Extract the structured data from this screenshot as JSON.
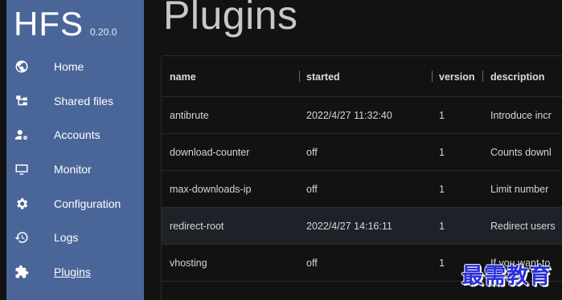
{
  "app": {
    "name": "HFS",
    "version": "0.20.0"
  },
  "sidebar": {
    "items": [
      {
        "label": "Home",
        "icon": "globe-icon"
      },
      {
        "label": "Shared files",
        "icon": "folder-tree-icon"
      },
      {
        "label": "Accounts",
        "icon": "user-gear-icon"
      },
      {
        "label": "Monitor",
        "icon": "monitor-icon"
      },
      {
        "label": "Configuration",
        "icon": "gear-icon"
      },
      {
        "label": "Logs",
        "icon": "history-icon"
      },
      {
        "label": "Plugins",
        "icon": "puzzle-icon",
        "active": true
      }
    ]
  },
  "main": {
    "title": "Plugins",
    "table": {
      "columns": [
        "name",
        "started",
        "version",
        "description"
      ],
      "rows": [
        {
          "name": "antibrute",
          "started": "2022/4/27 11:32:40",
          "version": "1",
          "description": "Introduce incr"
        },
        {
          "name": "download-counter",
          "started": "off",
          "version": "1",
          "description": "Counts downl"
        },
        {
          "name": "max-downloads-ip",
          "started": "off",
          "version": "1",
          "description": "Limit number"
        },
        {
          "name": "redirect-root",
          "started": "2022/4/27 14:16:11",
          "version": "1",
          "description": "Redirect users"
        },
        {
          "name": "vhosting",
          "started": "off",
          "version": "1",
          "description": "If you want to"
        }
      ]
    }
  },
  "watermark": {
    "text": "最需教育"
  },
  "colors": {
    "sidebar": "#4a6699",
    "background": "#121212",
    "highlight_row": "#1e2228"
  }
}
